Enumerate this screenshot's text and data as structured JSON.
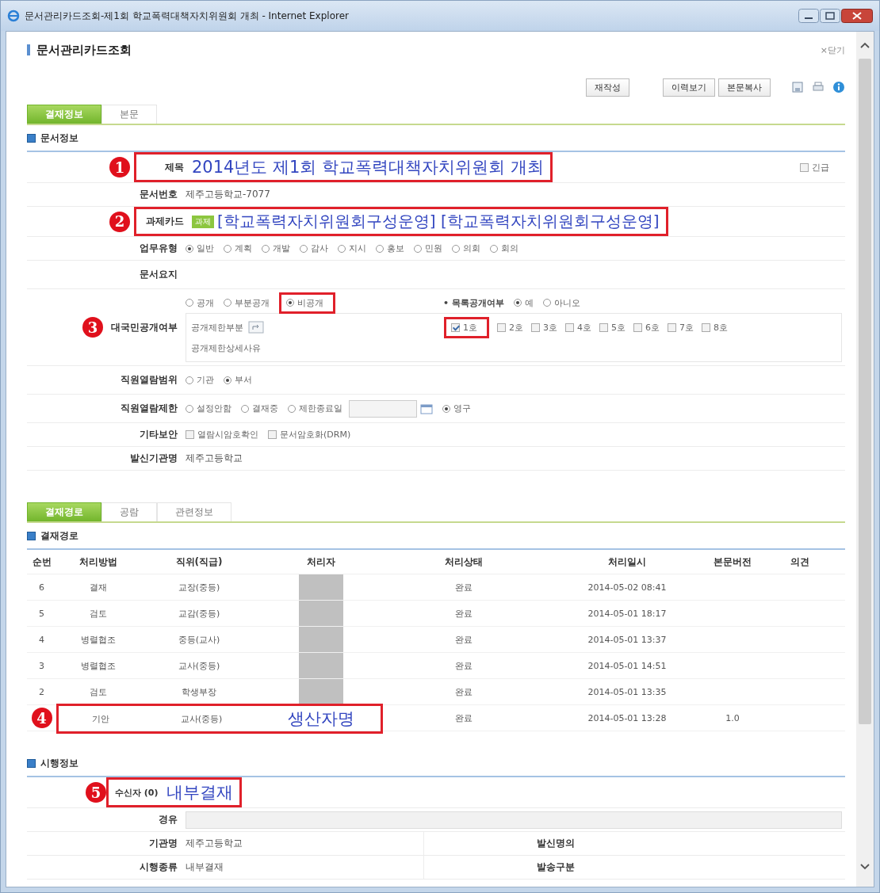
{
  "window": {
    "title": "문서관리카드조회-제1회 학교폭력대책자치위원회 개최 - Internet Explorer"
  },
  "header": {
    "title": "문서관리카드조회",
    "close": "×닫기"
  },
  "toolbar": {
    "buttons": [
      "재작성",
      "이력보기",
      "본문복사"
    ]
  },
  "tabs": [
    {
      "label": "결재정보",
      "selected": true
    },
    {
      "label": "본문",
      "selected": false
    }
  ],
  "doc_info": {
    "title": "문서정보",
    "subject": {
      "marker": "1",
      "label": "제목",
      "value": "2014년도 제1회 학교폭력대책자치위원회 개최"
    },
    "urgent": {
      "label": "긴급",
      "checked": false
    },
    "doc_number": {
      "label": "문서번호",
      "value": "제주고등학교-7077"
    },
    "task_card": {
      "marker": "2",
      "label": "과제카드",
      "badge": "과제",
      "value": "[학교폭력자치위원회구성운영] [학교폭력자치위원회구성운영]"
    },
    "work_type": {
      "label": "업무유형",
      "options": [
        {
          "label": "일반",
          "selected": true
        },
        {
          "label": "계획",
          "selected": false
        },
        {
          "label": "개발",
          "selected": false
        },
        {
          "label": "감사",
          "selected": false
        },
        {
          "label": "지시",
          "selected": false
        },
        {
          "label": "홍보",
          "selected": false
        },
        {
          "label": "민원",
          "selected": false
        },
        {
          "label": "의회",
          "selected": false
        },
        {
          "label": "회의",
          "selected": false
        }
      ]
    },
    "summary": {
      "label": "문서요지"
    },
    "disclosure": {
      "marker": "3",
      "label": "대국민공개여부",
      "options": [
        {
          "label": "공개",
          "selected": false,
          "highlighted": false
        },
        {
          "label": "부분공개",
          "selected": false,
          "highlighted": false
        },
        {
          "label": "비공개",
          "selected": true,
          "highlighted": true
        }
      ],
      "list_disclosure": {
        "label": "• 목록공개여부",
        "options": [
          {
            "label": "예",
            "selected": true
          },
          {
            "label": "아니오",
            "selected": false
          }
        ]
      },
      "restricted_part": "공개제한부분",
      "clauses": [
        {
          "label": "1호",
          "checked": true,
          "highlighted": true
        },
        {
          "label": "2호",
          "checked": false,
          "highlighted": false
        },
        {
          "label": "3호",
          "checked": false,
          "highlighted": false
        },
        {
          "label": "4호",
          "checked": false,
          "highlighted": false
        },
        {
          "label": "5호",
          "checked": false,
          "highlighted": false
        },
        {
          "label": "6호",
          "checked": false,
          "highlighted": false
        },
        {
          "label": "7호",
          "checked": false,
          "highlighted": false
        },
        {
          "label": "8호",
          "checked": false,
          "highlighted": false
        }
      ],
      "reason_label": "공개제한상세사유"
    },
    "read_scope": {
      "label": "직원열람범위",
      "options": [
        {
          "label": "기관",
          "selected": false
        },
        {
          "label": "부서",
          "selected": true
        }
      ]
    },
    "read_limit": {
      "label": "직원열람제한",
      "options": [
        {
          "kind": "radio",
          "label": "설정안함",
          "selected": false
        },
        {
          "kind": "radio",
          "label": "결재중",
          "selected": false
        },
        {
          "kind": "date",
          "label": "제한종료일",
          "selected": false
        },
        {
          "kind": "radio",
          "label": "영구",
          "selected": true
        }
      ]
    },
    "security": {
      "label": "기타보안",
      "options": [
        {
          "label": "열람시암호확인",
          "checked": false
        },
        {
          "label": "문서암호화(DRM)",
          "checked": false
        }
      ]
    },
    "sender_org": {
      "label": "발신기관명",
      "value": "제주고등학교"
    }
  },
  "tabs2": [
    {
      "label": "결재경로",
      "selected": true
    },
    {
      "label": "공람",
      "selected": false
    },
    {
      "label": "관련정보",
      "selected": false
    }
  ],
  "approval": {
    "title": "결재경로",
    "columns": [
      "순번",
      "처리방법",
      "직위(직급)",
      "처리자",
      "처리상태",
      "처리일시",
      "본문버전",
      "의견"
    ],
    "rows": [
      {
        "no": "6",
        "method": "결재",
        "position": "교장(중등)",
        "redacted": true,
        "status": "완료",
        "time": "2014-05-02 08:41"
      },
      {
        "no": "5",
        "method": "검토",
        "position": "교감(중등)",
        "redacted": true,
        "status": "완료",
        "time": "2014-05-01 18:17"
      },
      {
        "no": "4",
        "method": "병렬협조",
        "position": "중등(교사)",
        "redacted": true,
        "status": "완료",
        "time": "2014-05-01 13:37"
      },
      {
        "no": "3",
        "method": "병렬협조",
        "position": "교사(중등)",
        "redacted": true,
        "status": "완료",
        "time": "2014-05-01 14:51"
      },
      {
        "no": "2",
        "method": "검토",
        "position": "학생부장",
        "redacted": true,
        "status": "완료",
        "time": "2014-05-01 13:35"
      },
      {
        "marker": "4",
        "method": "기안",
        "position": "교사(중등)",
        "redacted": false,
        "processor": "생산자명",
        "status": "완료",
        "time": "2014-05-01 13:28",
        "version": "1.0"
      }
    ]
  },
  "enforcement": {
    "title": "시행정보",
    "recipient": {
      "marker": "5",
      "label": "수신자 (0)",
      "value": "내부결재"
    },
    "via": {
      "label": "경유"
    },
    "org": {
      "label": "기관명",
      "value": "제주고등학교"
    },
    "sender_name": {
      "label": "발신명의"
    },
    "type": {
      "label": "시행종류",
      "value": "내부결재"
    },
    "dispatch": {
      "label": "발송구분"
    }
  }
}
